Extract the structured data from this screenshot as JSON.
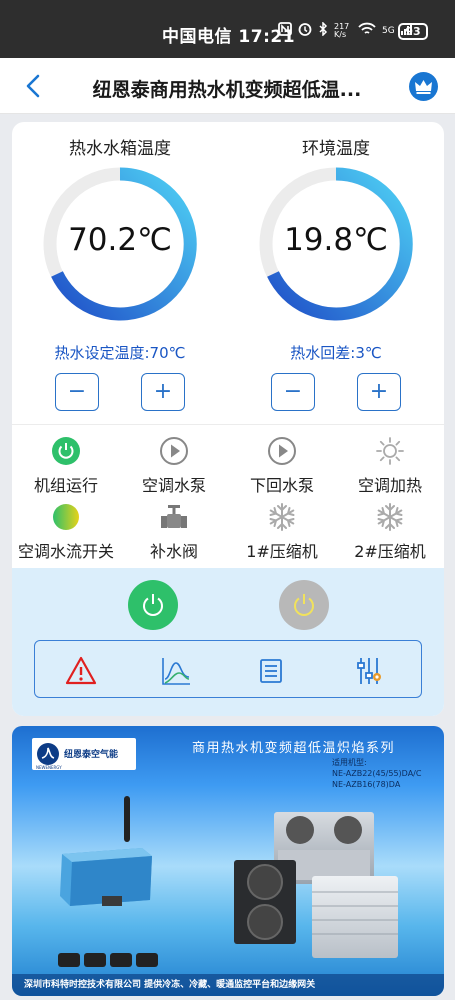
{
  "status_bar": {
    "carrier_time": "中国电信 17:21",
    "net_speed": "217 K/s",
    "signal": "5G",
    "battery": "93"
  },
  "header": {
    "title": "纽恩泰商用热水机变频超低温..."
  },
  "gauges": [
    {
      "title": "热水水箱温度",
      "value": "70.2℃",
      "setting": "热水设定温度:70℃",
      "level": 0.72
    },
    {
      "title": "环境温度",
      "value": "19.8℃",
      "setting": "热水回差:3℃",
      "level": 0.72
    }
  ],
  "controls": {
    "minus": "−",
    "plus": "+"
  },
  "status_items": [
    {
      "label": "机组运行",
      "icon": "power-on-icon"
    },
    {
      "label": "空调水泵",
      "icon": "pump-icon"
    },
    {
      "label": "下回水泵",
      "icon": "pump-icon"
    },
    {
      "label": "空调加热",
      "icon": "sun-icon"
    },
    {
      "label": "空调水流开关",
      "icon": "flow-switch-icon"
    },
    {
      "label": "补水阀",
      "icon": "valve-icon"
    },
    {
      "label": "1#压缩机",
      "icon": "snowflake-icon"
    },
    {
      "label": "2#压缩机",
      "icon": "snowflake-icon"
    }
  ],
  "colors": {
    "accent": "#1976d2",
    "power_on": "#2ec06a",
    "power_off": "#b8b8b8",
    "alarm": "#e02020"
  },
  "banner": {
    "logo_text": "纽恩泰空气能",
    "logo_sub": "NEWENERGY",
    "title": "商用热水机变频超低温炽焰系列",
    "model_label": "适用机型:",
    "model_1": "NE-AZB22(45/55)DA/C",
    "model_2": "NE-AZB16(78)DA",
    "footer": "深圳市科特时控技术有限公司   提供冷冻、冷藏、暖通监控平台和边缘网关"
  }
}
